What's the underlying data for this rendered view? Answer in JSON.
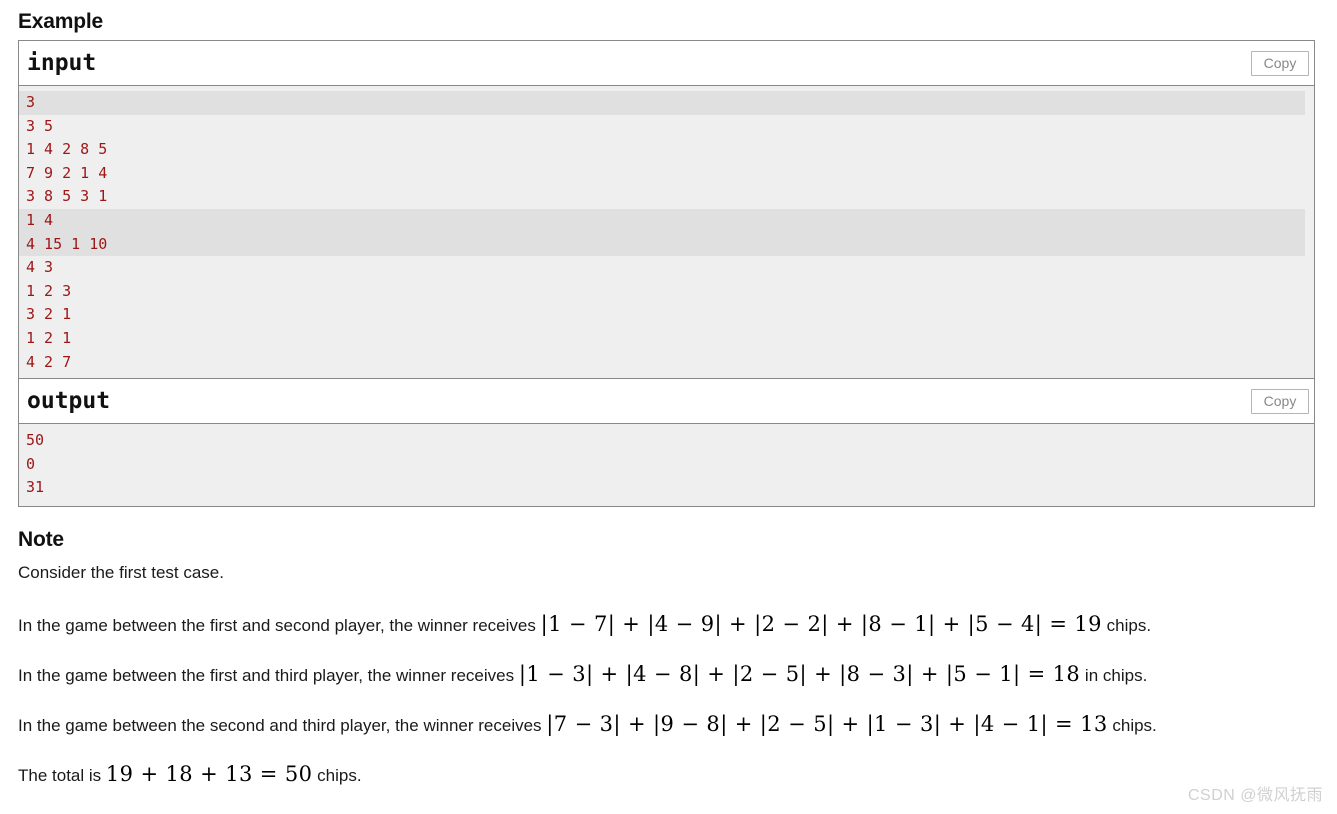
{
  "headings": {
    "example": "Example",
    "note": "Note"
  },
  "sample_tests": [
    {
      "id": "input",
      "header_label": "input",
      "copy_label": "Copy",
      "lines": [
        {
          "text": "3",
          "highlight": true
        },
        {
          "text": "3 5",
          "highlight": false
        },
        {
          "text": "1 4 2 8 5",
          "highlight": false
        },
        {
          "text": "7 9 2 1 4",
          "highlight": false
        },
        {
          "text": "3 8 5 3 1",
          "highlight": false
        },
        {
          "text": "1 4",
          "highlight": true
        },
        {
          "text": "4 15 1 10",
          "highlight": true
        },
        {
          "text": "4 3",
          "highlight": false
        },
        {
          "text": "1 2 3",
          "highlight": false
        },
        {
          "text": "3 2 1",
          "highlight": false
        },
        {
          "text": "1 2 1",
          "highlight": false
        },
        {
          "text": "4 2 7",
          "highlight": false
        }
      ]
    },
    {
      "id": "output",
      "header_label": "output",
      "copy_label": "Copy",
      "lines": [
        {
          "text": "50",
          "highlight": false
        },
        {
          "text": "0",
          "highlight": false
        },
        {
          "text": "31",
          "highlight": false
        }
      ]
    }
  ],
  "note": {
    "intro": "Consider the first test case.",
    "paragraphs": [
      {
        "lead": "In the game between the first and second player, the winner receives ",
        "math": "|1 − 7| + |4 − 9| + |2 − 2| + |8 − 1| + |5 − 4| = 19",
        "tail": " chips."
      },
      {
        "lead": "In the game between the first and third player, the winner receives ",
        "math": "|1 − 3| + |4 − 8| + |2 − 5| + |8 − 3| + |5 − 1| = 18",
        "tail": " in chips."
      },
      {
        "lead": "In the game between the second and third player, the winner receives ",
        "math": "|7 − 3| + |9 − 8| + |2 − 5| + |1 − 3| + |4 − 1| = 13",
        "tail": " chips."
      },
      {
        "lead": "The total is ",
        "math": "19 + 18 + 13 = 50",
        "tail": " chips."
      }
    ]
  },
  "watermark": "CSDN @微风抚雨",
  "colors": {
    "code_text": "#9c1616",
    "code_bg": "#efefef",
    "code_bg_highlight": "#e0e0e0",
    "border": "#888888",
    "watermark": "#d0d0d0"
  }
}
